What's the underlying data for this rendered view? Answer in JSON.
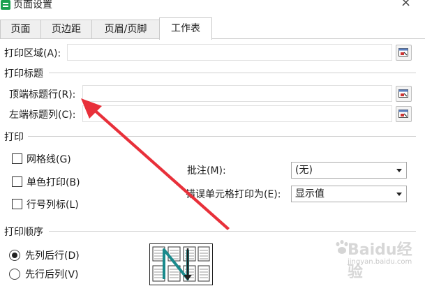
{
  "window": {
    "title": "页面设置",
    "close_glyph": "×"
  },
  "tabs": [
    {
      "label": "页面"
    },
    {
      "label": "页边距"
    },
    {
      "label": "页眉/页脚"
    },
    {
      "label": "工作表"
    }
  ],
  "print_area": {
    "label": "打印区域(A):",
    "value": ""
  },
  "print_titles": {
    "group_label": "打印标题",
    "top_rows": {
      "label": "顶端标题行(R):",
      "value": ""
    },
    "left_cols": {
      "label": "左端标题列(C):",
      "value": ""
    }
  },
  "print": {
    "group_label": "打印",
    "gridlines": {
      "label": "网格线(G)",
      "checked": false
    },
    "mono": {
      "label": "单色打印(B)",
      "checked": false
    },
    "row_col_headers": {
      "label": "行号列标(L)",
      "checked": false
    },
    "comments": {
      "label": "批注(M):",
      "value": "(无)"
    },
    "cell_errors": {
      "label": "错误单元格打印为(E):",
      "value": "显示值"
    }
  },
  "page_order": {
    "group_label": "打印顺序",
    "down_then_over": {
      "label": "先列后行(D)",
      "selected": true
    },
    "over_then_down": {
      "label": "先行后列(V)",
      "selected": false
    }
  },
  "annotation": {
    "color": "#e8303a"
  },
  "watermark": {
    "text": "Baidu经验",
    "url": "jingyan.baidu.com"
  }
}
